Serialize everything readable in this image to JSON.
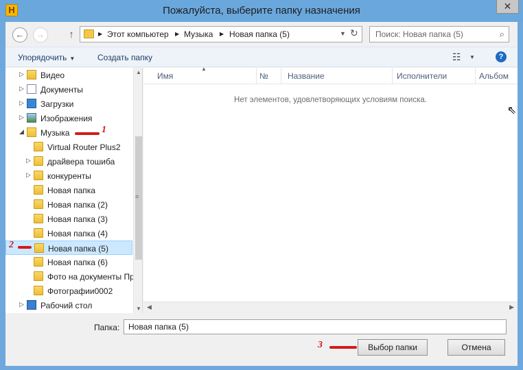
{
  "window": {
    "app_icon_letter": "H",
    "title": "Пожалуйста, выберите папку назначения",
    "close_symbol": "✕"
  },
  "nav": {
    "back_icon": "arrow-left-icon",
    "forward_icon": "arrow-right-icon",
    "up_icon": "arrow-up-icon",
    "breadcrumbs": [
      "Этот компьютер",
      "Музыка",
      "Новая папка (5)"
    ],
    "search_placeholder": "Поиск: Новая папка (5)"
  },
  "commands": {
    "organize": "Упорядочить",
    "new_folder": "Создать папку"
  },
  "tree": {
    "items": [
      {
        "label": "Видео",
        "icon": "video-folder-icon",
        "expander": "▷",
        "level": 0
      },
      {
        "label": "Документы",
        "icon": "documents-icon",
        "expander": "▷",
        "level": 0
      },
      {
        "label": "Загрузки",
        "icon": "downloads-icon",
        "expander": "▷",
        "level": 0
      },
      {
        "label": "Изображения",
        "icon": "pictures-icon",
        "expander": "▷",
        "level": 0
      },
      {
        "label": "Музыка",
        "icon": "music-folder-icon",
        "expander": "◢",
        "level": 0
      },
      {
        "label": "Virtual Router Plus2",
        "icon": "folder-icon",
        "expander": "",
        "level": 1
      },
      {
        "label": "драйвера тошиба",
        "icon": "folder-icon",
        "expander": "▷",
        "level": 1
      },
      {
        "label": "конкуренты",
        "icon": "folder-icon",
        "expander": "▷",
        "level": 1
      },
      {
        "label": "Новая папка",
        "icon": "folder-icon",
        "expander": "",
        "level": 1
      },
      {
        "label": "Новая папка (2)",
        "icon": "folder-icon",
        "expander": "",
        "level": 1
      },
      {
        "label": "Новая папка (3)",
        "icon": "folder-icon",
        "expander": "",
        "level": 1
      },
      {
        "label": "Новая папка (4)",
        "icon": "folder-icon",
        "expander": "",
        "level": 1
      },
      {
        "label": "Новая папка (5)",
        "icon": "folder-icon",
        "expander": "",
        "level": 1,
        "selected": true
      },
      {
        "label": "Новая папка (6)",
        "icon": "folder-icon",
        "expander": "",
        "level": 1
      },
      {
        "label": "Фото на документы Пр",
        "icon": "folder-icon",
        "expander": "",
        "level": 1
      },
      {
        "label": "Фотографии0002",
        "icon": "folder-icon",
        "expander": "",
        "level": 1
      },
      {
        "label": "Рабочий стол",
        "icon": "desktop-icon",
        "expander": "▷",
        "level": 0
      }
    ]
  },
  "list": {
    "columns": [
      "Имя",
      "№",
      "Название",
      "Исполнители",
      "Альбом"
    ],
    "empty_message": "Нет элементов, удовлетворяющих условиям поиска."
  },
  "footer": {
    "folder_label": "Папка:",
    "folder_value": "Новая папка (5)",
    "select_button": "Выбор папки",
    "cancel_button": "Отмена"
  },
  "annotations": {
    "one": "1",
    "two": "2",
    "three": "3",
    "color": "#d21b1b"
  }
}
